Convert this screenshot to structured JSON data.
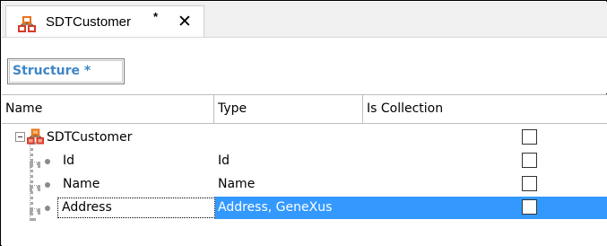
{
  "tab": {
    "title": "SDTCustomer",
    "dirty_marker": "*",
    "close_glyph": "✕",
    "icon": "sdt-structure-icon"
  },
  "subtab": {
    "label": "Structure *"
  },
  "grid": {
    "columns": [
      "Name",
      "Type",
      "Is Collection"
    ],
    "root": {
      "name": "SDTCustomer",
      "type": "",
      "is_collection": false,
      "icon": "sdt-structure-icon"
    },
    "items": [
      {
        "name": "Id",
        "type": "Id",
        "is_collection": false,
        "selected": false
      },
      {
        "name": "Name",
        "type": "Name",
        "is_collection": false,
        "selected": false
      },
      {
        "name": "Address",
        "type": "Address, GeneXus",
        "is_collection": false,
        "selected": true
      }
    ]
  },
  "colors": {
    "selection": "#3399ff",
    "subtab_text": "#3e86c7",
    "icon_orange": "#e8741e",
    "icon_red": "#d83a2a"
  }
}
